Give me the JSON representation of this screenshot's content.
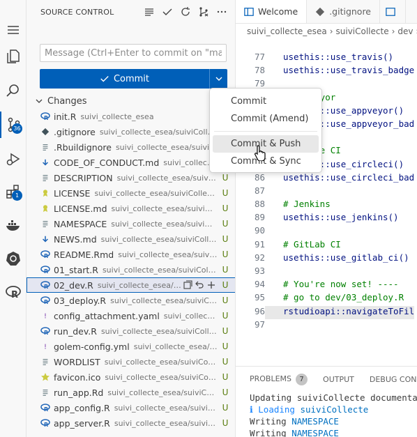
{
  "activity_bar": {
    "source_control_badge": "36",
    "extensions_badge": "1"
  },
  "source_control": {
    "title": "SOURCE CONTROL",
    "message_placeholder": "Message (Ctrl+Enter to commit on \"main\")",
    "commit_label": "Commit",
    "changes_label": "Changes",
    "files": [
      {
        "name": "init.R",
        "path": "suivi_collecte_esea",
        "status": "",
        "icon": "r-file-icon"
      },
      {
        "name": ".gitignore",
        "path": "suivi_collecte_esea/suiviCollecte",
        "status": "",
        "icon": "git-icon"
      },
      {
        "name": ".Rbuildignore",
        "path": "suivi_collecte_esea/suiviCol...",
        "status": "",
        "icon": "text-file-icon"
      },
      {
        "name": "CODE_OF_CONDUCT.md",
        "path": "suivi_collecte_...",
        "status": "",
        "icon": "markdown-icon"
      },
      {
        "name": "DESCRIPTION",
        "path": "suivi_collecte_esea/suiviCollecte",
        "status": "U",
        "icon": "text-file-icon"
      },
      {
        "name": "LICENSE",
        "path": "suivi_collecte_esea/suiviCollecte",
        "status": "U",
        "icon": "license-icon"
      },
      {
        "name": "LICENSE.md",
        "path": "suivi_collecte_esea/suiviColle...",
        "status": "U",
        "icon": "license-icon"
      },
      {
        "name": "NAMESPACE",
        "path": "suivi_collecte_esea/suiviColl...",
        "status": "U",
        "icon": "text-file-icon"
      },
      {
        "name": "NEWS.md",
        "path": "suivi_collecte_esea/suiviCollecte",
        "status": "U",
        "icon": "markdown-icon"
      },
      {
        "name": "README.Rmd",
        "path": "suivi_collecte_esea/suiviCo...",
        "status": "U",
        "icon": "r-file-icon"
      },
      {
        "name": "01_start.R",
        "path": "suivi_collecte_esea/suiviCollect...",
        "status": "U",
        "icon": "r-file-icon"
      },
      {
        "name": "02_dev.R",
        "path": "suivi_collecte_esea/s...",
        "status": "U",
        "icon": "r-file-icon"
      },
      {
        "name": "03_deploy.R",
        "path": "suivi_collecte_esea/suiviColle...",
        "status": "U",
        "icon": "r-file-icon"
      },
      {
        "name": "config_attachment.yaml",
        "path": "suivi_collecte_e...",
        "status": "U",
        "icon": "yaml-icon"
      },
      {
        "name": "run_dev.R",
        "path": "suivi_collecte_esea/suiviCollect...",
        "status": "U",
        "icon": "r-file-icon"
      },
      {
        "name": "golem-config.yml",
        "path": "suivi_collecte_esea/sui...",
        "status": "U",
        "icon": "yaml-icon"
      },
      {
        "name": "WORDLIST",
        "path": "suivi_collecte_esea/suiviCollec...",
        "status": "U",
        "icon": "text-file-icon"
      },
      {
        "name": "favicon.ico",
        "path": "suivi_collecte_esea/suiviCollec...",
        "status": "U",
        "icon": "star-icon"
      },
      {
        "name": "run_app.Rd",
        "path": "suivi_collecte_esea/suiviCollec...",
        "status": "U",
        "icon": "text-file-icon"
      },
      {
        "name": "app_config.R",
        "path": "suivi_collecte_esea/suiviColl...",
        "status": "U",
        "icon": "r-file-icon"
      },
      {
        "name": "app_server.R",
        "path": "suivi_collecte_esea/suiviColl...",
        "status": "U",
        "icon": "r-file-icon"
      }
    ]
  },
  "editor": {
    "tabs": [
      {
        "label": "Welcome"
      },
      {
        "label": ".gitignore"
      }
    ],
    "breadcrumb": [
      "suivi_collecte_esea",
      "suiviCollecte",
      "dev"
    ],
    "code_lines": [
      {
        "n": "77",
        "text": "usethis::use_travis()",
        "kind": "code"
      },
      {
        "n": "78",
        "text": "usethis::use_travis_badge",
        "kind": "code"
      },
      {
        "n": "79",
        "text": "",
        "kind": "code"
      },
      {
        "n": "80",
        "text": "# AppVeyor",
        "kind": "comment"
      },
      {
        "n": "81",
        "text": "usethis::use_appveyor()",
        "kind": "code"
      },
      {
        "n": "82",
        "text": "usethis::use_appveyor_bad",
        "kind": "code"
      },
      {
        "n": "83",
        "text": "",
        "kind": "code"
      },
      {
        "n": "84",
        "text": "# Circle CI",
        "kind": "comment"
      },
      {
        "n": "85",
        "text": "usethis::use_circleci()",
        "kind": "code"
      },
      {
        "n": "86",
        "text": "usethis::use_circleci_bad",
        "kind": "code"
      },
      {
        "n": "87",
        "text": "",
        "kind": "code"
      },
      {
        "n": "88",
        "text": "# Jenkins",
        "kind": "comment"
      },
      {
        "n": "89",
        "text": "usethis::use_jenkins()",
        "kind": "code"
      },
      {
        "n": "90",
        "text": "",
        "kind": "code"
      },
      {
        "n": "91",
        "text": "# GitLab CI",
        "kind": "comment"
      },
      {
        "n": "92",
        "text": "usethis::use_gitlab_ci()",
        "kind": "code"
      },
      {
        "n": "93",
        "text": "",
        "kind": "code"
      },
      {
        "n": "94",
        "text": "# You're now set! ----",
        "kind": "comment"
      },
      {
        "n": "95",
        "text": "# go to dev/03_deploy.R",
        "kind": "comment"
      },
      {
        "n": "96",
        "text": "rstudioapi::navigateToFil",
        "kind": "highlight"
      },
      {
        "n": "97",
        "text": "",
        "kind": "code"
      }
    ]
  },
  "panel": {
    "problems_label": "PROBLEMS",
    "problems_count": "7",
    "output_label": "OUTPUT",
    "debug_label": "DEBUG CONSO",
    "lines": [
      {
        "prefix": "",
        "text": "Updating suiviCollecte documentatio"
      },
      {
        "prefix": "ℹ Loading ",
        "text": "suiviCollecte"
      },
      {
        "prefix": "Writing ",
        "text": "NAMESPACE"
      },
      {
        "prefix": "Writing ",
        "text": "NAMESPACE"
      }
    ]
  },
  "commit_menu": {
    "items": [
      {
        "label": "Commit"
      },
      {
        "label": "Commit (Amend)"
      },
      {
        "label": "Commit & Push"
      },
      {
        "label": "Commit & Sync"
      }
    ]
  }
}
